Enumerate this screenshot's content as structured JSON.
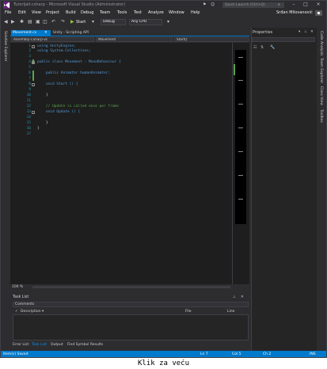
{
  "window": {
    "title": "Tutorijali-csharp - Microsoft Visual Studio (Administrator)",
    "quick_launch_placeholder": "Quick Launch (Ctrl+Q)",
    "user": "Srđan Milovanović"
  },
  "menu": [
    "File",
    "Edit",
    "View",
    "Project",
    "Build",
    "Debug",
    "Team",
    "Tools",
    "Test",
    "Analyze",
    "Window",
    "Help"
  ],
  "toolbar": {
    "start_label": "Start",
    "config": "Debug",
    "platform": "Any CPU"
  },
  "left_tabs": [
    "Solution Explorer"
  ],
  "editor": {
    "tabs": [
      {
        "label": "Movement.cs",
        "active": true
      },
      {
        "label": "Unity - Scripting API",
        "active": false
      }
    ],
    "nav": {
      "project": "Assembly-CSharp-vs",
      "class": "Movement",
      "member": "Start()"
    },
    "line_numbers": [
      "1",
      "2",
      "3",
      "4",
      "5",
      "6",
      "7",
      "8",
      "9",
      "10",
      "11",
      "12",
      "13",
      "14",
      "15",
      "16",
      "17"
    ],
    "code": [
      "using UnityEngine;",
      "using System.Collections;",
      "",
      "public class Movement : MonoBehaviour {",
      "",
      "    public Animator humanAnimator;",
      "",
      "    void Start () {",
      "",
      "    }",
      "",
      "    // Update is called once per frame",
      "    void Update () {",
      "",
      "    }",
      "}",
      ""
    ],
    "zoom": "100 %"
  },
  "task_list": {
    "title": "Task List",
    "filter": "Comments",
    "columns": [
      "Description",
      "File",
      "Line"
    ]
  },
  "bottom_tabs": [
    "Error List",
    "Task List",
    "Output",
    "Find Symbol Results"
  ],
  "properties": {
    "title": "Properties"
  },
  "right_tabs": [
    "Code Analysis",
    "Team Explorer",
    "Class View",
    "Toolbox"
  ],
  "status": {
    "message": "Item(s) Saved",
    "line": "Ln 7",
    "col": "Col 5",
    "ch": "Ch 2",
    "mode": "INS"
  },
  "caption": "Klik za veću",
  "colors": {
    "accent": "#007acc",
    "background": "#2d2d30",
    "editor": "#1e1e1e",
    "keyword": "#569cd6",
    "type": "#4ec9b0",
    "comment": "#57a64a"
  }
}
